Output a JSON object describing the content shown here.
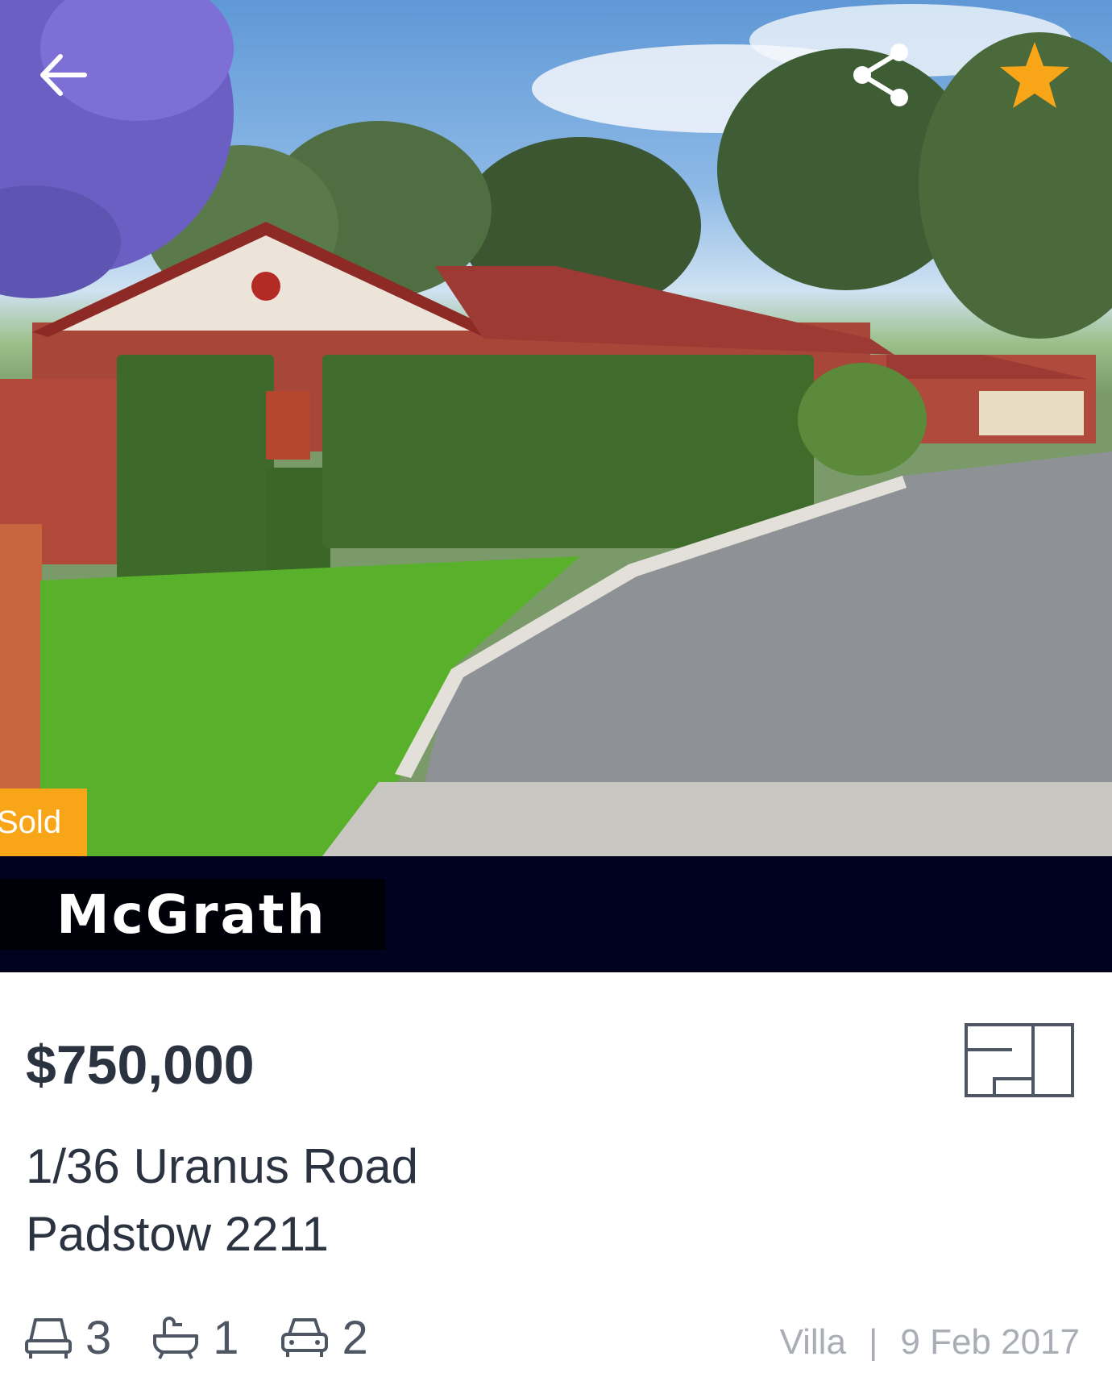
{
  "listing": {
    "status_badge": "Sold",
    "agency_name": "McGrath",
    "price": "$750,000",
    "address_line1": "1/36 Uranus Road",
    "address_line2": "Padstow 2211",
    "bedrooms": "3",
    "bathrooms": "1",
    "car_spaces": "2",
    "property_type": "Villa",
    "separator": "|",
    "date": "9 Feb 2017"
  },
  "icons": {
    "back": "arrow-left-icon",
    "share": "share-icon",
    "favorite": "star-icon",
    "floorplan": "floorplan-icon",
    "bed": "bed-icon",
    "bath": "bath-icon",
    "car": "car-icon"
  },
  "colors": {
    "accent": "#f8a518",
    "agency_bar": "#01021e",
    "text_primary": "#2b3240",
    "text_muted": "#a9adb4"
  }
}
